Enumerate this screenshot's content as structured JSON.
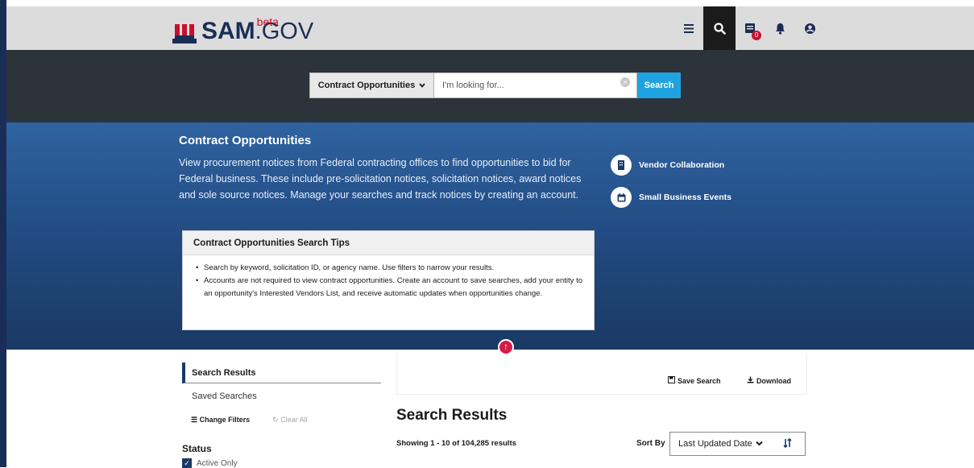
{
  "brand": {
    "name": "SAM",
    "tld": ".GOV",
    "badge": "beta"
  },
  "nav": {
    "icons": [
      "menu-icon",
      "search-icon",
      "workspace-icon",
      "bell-icon",
      "user-icon"
    ],
    "notification_count": "0"
  },
  "search": {
    "domain": "Contract Opportunities",
    "placeholder": "I'm looking for...",
    "button": "Search"
  },
  "hero": {
    "title": "Contract Opportunities",
    "description": "View procurement notices from Federal contracting offices to find opportunities to bid for Federal business. These include pre-solicitation notices, solicitation notices, award notices and sole source notices. Manage your searches and track notices by creating an account.",
    "links": [
      {
        "label": "Vendor Collaboration",
        "icon": "building-icon"
      },
      {
        "label": "Small Business Events",
        "icon": "calendar-icon"
      }
    ],
    "tips": {
      "title": "Contract Opportunities Search Tips",
      "items": [
        "Search by keyword, solicitation ID, or agency name. Use filters to narrow your results.",
        "Accounts are not required to view contract opportunities. Create an account to save searches, add your entity to an opportunity's Interested Vendors List, and receive automatic updates when opportunities change."
      ]
    }
  },
  "sidenav": {
    "items": [
      "Search Results",
      "Saved Searches"
    ],
    "change_filters": "Change Filters",
    "clear_all": "Clear All",
    "status_label": "Status",
    "status_option": "Active Only"
  },
  "results": {
    "save_search": "Save Search",
    "download": "Download",
    "title": "Search Results",
    "count_text": "Showing 1 - 10 of 104,285 results",
    "sort_label": "Sort By",
    "sort_value": "Last Updated Date"
  },
  "colors": {
    "navy": "#1a2d57",
    "red": "#c8102e",
    "search_button": "#1fa3e0",
    "hero_top": "#2f63a0",
    "hero_bottom": "#1a3964"
  }
}
